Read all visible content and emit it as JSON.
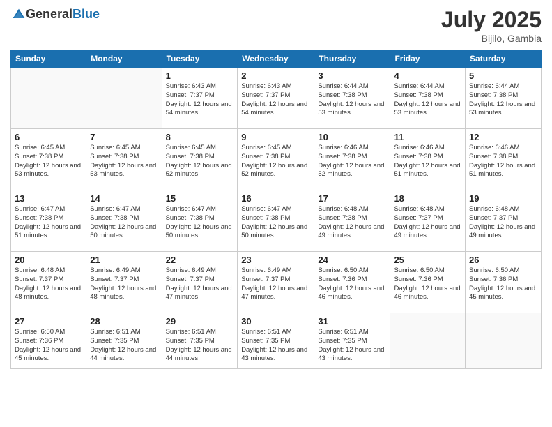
{
  "header": {
    "logo_general": "General",
    "logo_blue": "Blue",
    "month_year": "July 2025",
    "location": "Bijilo, Gambia"
  },
  "days_of_week": [
    "Sunday",
    "Monday",
    "Tuesday",
    "Wednesday",
    "Thursday",
    "Friday",
    "Saturday"
  ],
  "weeks": [
    [
      {
        "day": "",
        "info": ""
      },
      {
        "day": "",
        "info": ""
      },
      {
        "day": "1",
        "info": "Sunrise: 6:43 AM\nSunset: 7:37 PM\nDaylight: 12 hours and 54 minutes."
      },
      {
        "day": "2",
        "info": "Sunrise: 6:43 AM\nSunset: 7:37 PM\nDaylight: 12 hours and 54 minutes."
      },
      {
        "day": "3",
        "info": "Sunrise: 6:44 AM\nSunset: 7:38 PM\nDaylight: 12 hours and 53 minutes."
      },
      {
        "day": "4",
        "info": "Sunrise: 6:44 AM\nSunset: 7:38 PM\nDaylight: 12 hours and 53 minutes."
      },
      {
        "day": "5",
        "info": "Sunrise: 6:44 AM\nSunset: 7:38 PM\nDaylight: 12 hours and 53 minutes."
      }
    ],
    [
      {
        "day": "6",
        "info": "Sunrise: 6:45 AM\nSunset: 7:38 PM\nDaylight: 12 hours and 53 minutes."
      },
      {
        "day": "7",
        "info": "Sunrise: 6:45 AM\nSunset: 7:38 PM\nDaylight: 12 hours and 53 minutes."
      },
      {
        "day": "8",
        "info": "Sunrise: 6:45 AM\nSunset: 7:38 PM\nDaylight: 12 hours and 52 minutes."
      },
      {
        "day": "9",
        "info": "Sunrise: 6:45 AM\nSunset: 7:38 PM\nDaylight: 12 hours and 52 minutes."
      },
      {
        "day": "10",
        "info": "Sunrise: 6:46 AM\nSunset: 7:38 PM\nDaylight: 12 hours and 52 minutes."
      },
      {
        "day": "11",
        "info": "Sunrise: 6:46 AM\nSunset: 7:38 PM\nDaylight: 12 hours and 51 minutes."
      },
      {
        "day": "12",
        "info": "Sunrise: 6:46 AM\nSunset: 7:38 PM\nDaylight: 12 hours and 51 minutes."
      }
    ],
    [
      {
        "day": "13",
        "info": "Sunrise: 6:47 AM\nSunset: 7:38 PM\nDaylight: 12 hours and 51 minutes."
      },
      {
        "day": "14",
        "info": "Sunrise: 6:47 AM\nSunset: 7:38 PM\nDaylight: 12 hours and 50 minutes."
      },
      {
        "day": "15",
        "info": "Sunrise: 6:47 AM\nSunset: 7:38 PM\nDaylight: 12 hours and 50 minutes."
      },
      {
        "day": "16",
        "info": "Sunrise: 6:47 AM\nSunset: 7:38 PM\nDaylight: 12 hours and 50 minutes."
      },
      {
        "day": "17",
        "info": "Sunrise: 6:48 AM\nSunset: 7:38 PM\nDaylight: 12 hours and 49 minutes."
      },
      {
        "day": "18",
        "info": "Sunrise: 6:48 AM\nSunset: 7:37 PM\nDaylight: 12 hours and 49 minutes."
      },
      {
        "day": "19",
        "info": "Sunrise: 6:48 AM\nSunset: 7:37 PM\nDaylight: 12 hours and 49 minutes."
      }
    ],
    [
      {
        "day": "20",
        "info": "Sunrise: 6:48 AM\nSunset: 7:37 PM\nDaylight: 12 hours and 48 minutes."
      },
      {
        "day": "21",
        "info": "Sunrise: 6:49 AM\nSunset: 7:37 PM\nDaylight: 12 hours and 48 minutes."
      },
      {
        "day": "22",
        "info": "Sunrise: 6:49 AM\nSunset: 7:37 PM\nDaylight: 12 hours and 47 minutes."
      },
      {
        "day": "23",
        "info": "Sunrise: 6:49 AM\nSunset: 7:37 PM\nDaylight: 12 hours and 47 minutes."
      },
      {
        "day": "24",
        "info": "Sunrise: 6:50 AM\nSunset: 7:36 PM\nDaylight: 12 hours and 46 minutes."
      },
      {
        "day": "25",
        "info": "Sunrise: 6:50 AM\nSunset: 7:36 PM\nDaylight: 12 hours and 46 minutes."
      },
      {
        "day": "26",
        "info": "Sunrise: 6:50 AM\nSunset: 7:36 PM\nDaylight: 12 hours and 45 minutes."
      }
    ],
    [
      {
        "day": "27",
        "info": "Sunrise: 6:50 AM\nSunset: 7:36 PM\nDaylight: 12 hours and 45 minutes."
      },
      {
        "day": "28",
        "info": "Sunrise: 6:51 AM\nSunset: 7:35 PM\nDaylight: 12 hours and 44 minutes."
      },
      {
        "day": "29",
        "info": "Sunrise: 6:51 AM\nSunset: 7:35 PM\nDaylight: 12 hours and 44 minutes."
      },
      {
        "day": "30",
        "info": "Sunrise: 6:51 AM\nSunset: 7:35 PM\nDaylight: 12 hours and 43 minutes."
      },
      {
        "day": "31",
        "info": "Sunrise: 6:51 AM\nSunset: 7:35 PM\nDaylight: 12 hours and 43 minutes."
      },
      {
        "day": "",
        "info": ""
      },
      {
        "day": "",
        "info": ""
      }
    ]
  ]
}
